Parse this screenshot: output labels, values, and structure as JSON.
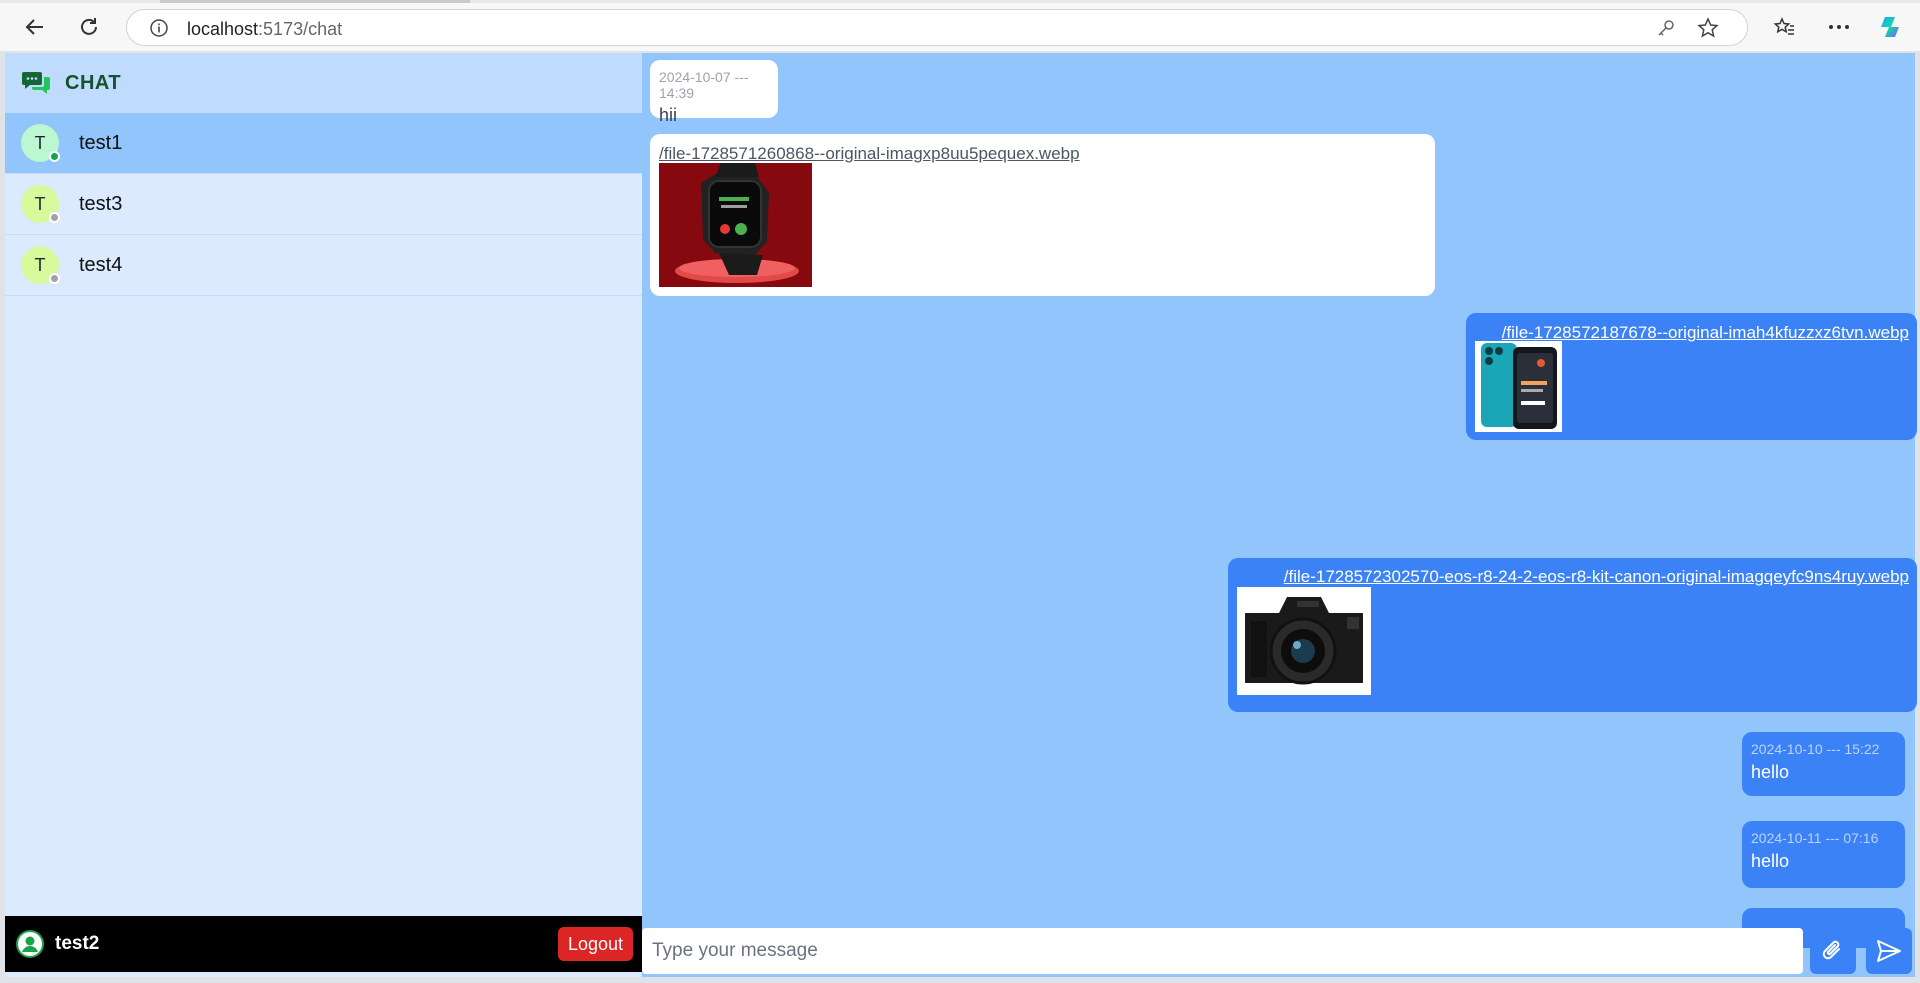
{
  "browser": {
    "url_host": "localhost",
    "url_path": ":5173/chat"
  },
  "sidebar": {
    "brand": "CHAT",
    "contacts": [
      {
        "initial": "T",
        "name": "test1",
        "online": true,
        "active": true
      },
      {
        "initial": "T",
        "name": "test3",
        "online": false,
        "active": false
      },
      {
        "initial": "T",
        "name": "test4",
        "online": false,
        "active": false
      }
    ],
    "current_user": "test2",
    "logout_label": "Logout"
  },
  "messages": [
    {
      "direction": "in",
      "timestamp": "2024-10-07 --- 14:39",
      "text": "hii"
    },
    {
      "direction": "in",
      "file": "/file-1728571260868--original-imagxp8uu5pequex.webp",
      "image": "smartwatch"
    },
    {
      "direction": "out",
      "file": "/file-1728572187678--original-imah4kfuzzxz6tvn.webp",
      "image": "smartphone"
    },
    {
      "direction": "out",
      "file": "/file-1728572302570-eos-r8-24-2-eos-r8-kit-canon-original-imagqeyfc9ns4ruy.webp",
      "image": "camera"
    },
    {
      "direction": "out",
      "timestamp": "2024-10-10 --- 15:22",
      "text": "hello"
    },
    {
      "direction": "out",
      "timestamp": "2024-10-11 --- 07:16",
      "text": "hello"
    }
  ],
  "composer": {
    "placeholder": "Type your message"
  },
  "colors": {
    "sidebar_bg": "#dbeafe",
    "header_bg": "#bfdbfe",
    "chat_bg": "#93c5fd",
    "outgoing_bubble": "#3b82f6",
    "online_dot": "#16a34a",
    "offline_dot": "#9ca3af",
    "logout": "#dc2626"
  }
}
